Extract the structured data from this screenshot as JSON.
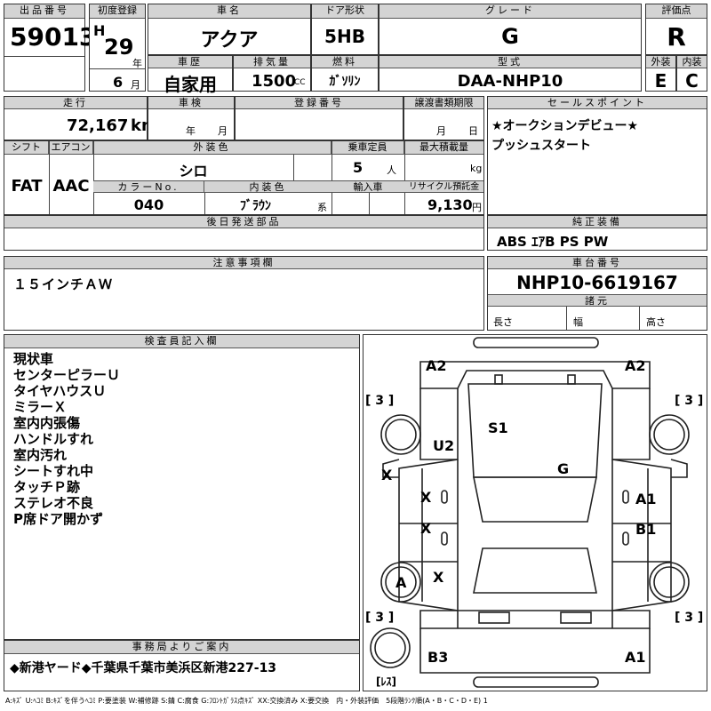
{
  "lot": {
    "label": "出品番号",
    "value": "59013"
  },
  "first_reg": {
    "label": "初度登録",
    "era": "H",
    "year": "29",
    "year_unit": "年",
    "month": "6",
    "month_unit": "月"
  },
  "car_name": {
    "label": "車名",
    "value": "アクア"
  },
  "door": {
    "label": "ドア形状",
    "value": "5HB"
  },
  "grade": {
    "label": "グレード",
    "value": "G"
  },
  "score": {
    "label": "評価点",
    "value": "R"
  },
  "history": {
    "label": "車歴",
    "value": "自家用"
  },
  "displacement": {
    "label": "排気量",
    "value": "1500",
    "unit": "CC"
  },
  "fuel": {
    "label": "燃料",
    "value": "ｶﾞｿﾘﾝ"
  },
  "model": {
    "label": "型式",
    "value": "DAA-NHP10"
  },
  "exterior_grade": {
    "label": "外装",
    "value": "E"
  },
  "interior_grade": {
    "label": "内装",
    "value": "C"
  },
  "mileage": {
    "label": "走行",
    "value": "72,167",
    "unit": "km"
  },
  "inspection": {
    "label": "車検",
    "year_unit": "年",
    "month_unit": "月"
  },
  "registration": {
    "label": "登録番号"
  },
  "transfer_deadline": {
    "label": "譲渡書類期限",
    "month_unit": "月",
    "day_unit": "日"
  },
  "shift": {
    "label": "シフト",
    "value": "FAT"
  },
  "aircon": {
    "label": "エアコン",
    "value": "AAC"
  },
  "ext_color": {
    "label": "外装色",
    "value": "シロ"
  },
  "capacity": {
    "label": "乗車定員",
    "value": "5",
    "unit": "人"
  },
  "max_load": {
    "label": "最大積載量",
    "unit": "kg"
  },
  "color_no": {
    "label": "カラーNo.",
    "value": "040"
  },
  "int_color": {
    "label": "内装色",
    "value": "ﾌﾞﾗｳﾝ",
    "unit": "系"
  },
  "import": {
    "label": "輸入車"
  },
  "recycle": {
    "label": "リサイクル預託金",
    "value": "9,130",
    "unit": "円"
  },
  "sales_points": {
    "label": "セールスポイント",
    "lines": [
      "★オークションデビュー★",
      "プッシュスタート"
    ]
  },
  "later_parts": {
    "label": "後日発送部品"
  },
  "equipment": {
    "label": "純正装備",
    "value": "ABS ｴｱB PS PW"
  },
  "caution": {
    "label": "注意事項欄",
    "value": "１５インチＡＷ"
  },
  "chassis": {
    "label": "車台番号",
    "value": "NHP10-6619167"
  },
  "dims": {
    "label": "諸元",
    "length": "長さ",
    "width": "幅",
    "height": "高さ"
  },
  "inspector": {
    "label": "検査員記入欄",
    "lines": [
      "現状車",
      "センターピラーＵ",
      "タイヤハウスＵ",
      "ミラーＸ",
      "室内内張傷",
      "ハンドルすれ",
      "室内汚れ",
      "シートすれ中",
      "タッチＰ跡",
      "ステレオ不良",
      "P席ドア開かず"
    ]
  },
  "office": {
    "label": "事務局よりご案内",
    "value": "◆新港ヤード◆千葉県千葉市美浜区新港227-13"
  },
  "diagram": {
    "marks": {
      "a2_left": "A2",
      "a2_right": "A2",
      "u2": "U2",
      "s1": "S1",
      "g": "G",
      "x_left_door": "X",
      "x_front": "X",
      "x_rear": "X",
      "x_rear_wheel": "X",
      "a1_door": "A1",
      "b1_door": "B1",
      "a_wheel": "A",
      "b3": "B3",
      "a1_rear": "A1"
    },
    "tires": {
      "fl": "[ 3 ]",
      "fr": "[ 3 ]",
      "rl": "[ 3 ]",
      "rr": "[ 3 ]"
    },
    "spare": "[ﾚｽ]"
  },
  "legend": "A:ｷｽﾞ U:ﾍｺﾐ B:ｷｽﾞを伴うﾍｺﾐ P:要塗装 W:補修跡 S:錆 C:腐食 G:ﾌﾛﾝﾄｶﾞﾗｽ点ｷｽﾞ XX:交換済み X:要交換　内・外装評価　5段階ﾗﾝｸ順(A・B・C・D・E) 1"
}
